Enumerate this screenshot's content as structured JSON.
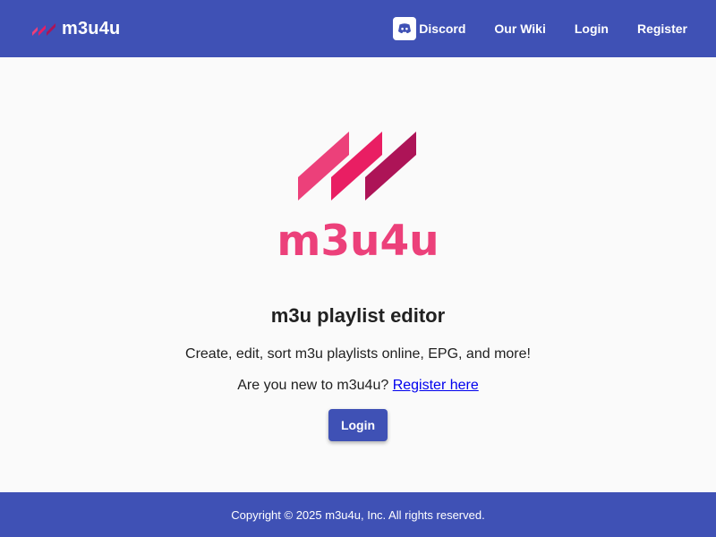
{
  "navbar": {
    "brand": "m3u4u",
    "links": {
      "discord": "Discord",
      "wiki": "Our Wiki",
      "login": "Login",
      "register": "Register"
    }
  },
  "hero": {
    "logo_text": "m3u4u",
    "headline": "m3u playlist editor",
    "tagline": "Create, edit, sort m3u playlists online, EPG, and more!",
    "new_user_prompt": "Are you new to m3u4u?",
    "register_link": "Register here",
    "login_button": "Login"
  },
  "footer": {
    "copyright": "Copyright © 2025 m3u4u, Inc. All rights reserved."
  },
  "colors": {
    "primary": "#3f51b5",
    "background": "#fafafa",
    "logo_pink": "#ec407a",
    "logo_magenta": "#e91e63",
    "logo_crimson": "#ad1457",
    "link": "#0000ee"
  },
  "icons": {
    "brand": "m3u4u-logo-icon",
    "discord": "discord-icon"
  }
}
